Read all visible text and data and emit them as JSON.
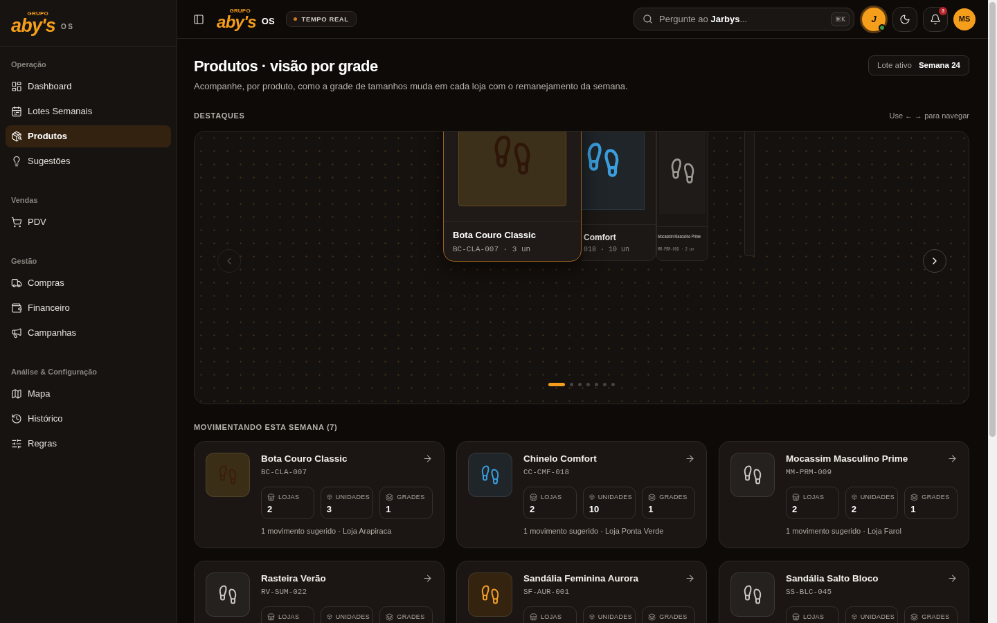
{
  "sidebar": {
    "logo": {
      "group": "GRUPO",
      "brand": "aby's",
      "suffix": "OS"
    },
    "sections": [
      {
        "title": "Operação",
        "items": [
          {
            "label": "Dashboard",
            "selected": false
          },
          {
            "label": "Lotes Semanais",
            "selected": false
          },
          {
            "label": "Produtos",
            "selected": true
          },
          {
            "label": "Sugestões",
            "selected": false
          }
        ]
      },
      {
        "title": "Vendas",
        "items": [
          {
            "label": "PDV",
            "selected": false
          }
        ]
      },
      {
        "title": "Gestão",
        "items": [
          {
            "label": "Compras",
            "selected": false
          },
          {
            "label": "Financeiro",
            "selected": false
          },
          {
            "label": "Campanhas",
            "selected": false
          }
        ]
      },
      {
        "title": "Análise & Configuração",
        "items": [
          {
            "label": "Mapa",
            "selected": false
          },
          {
            "label": "Histórico",
            "selected": false
          },
          {
            "label": "Regras",
            "selected": false
          }
        ]
      }
    ]
  },
  "header": {
    "logo": {
      "group": "GRUPO",
      "brand": "aby's",
      "suffix": "OS"
    },
    "status": {
      "label": "TEMPO REAL",
      "live": true
    },
    "search": {
      "placeholder": "Pergunte ao **Jarbys**...",
      "shortcut": "⌘K"
    },
    "assistant": {
      "initial": "J",
      "online": true
    },
    "notifications": {
      "count": "3"
    },
    "user": {
      "initials": "MS"
    }
  },
  "page": {
    "title": "Produtos · visão por grade",
    "subtitle": "Acompanhe, por produto, como a grade de tamanhos muda em cada loja com o remanejamento da semana.",
    "batch": {
      "label": "Lote ativo",
      "value": "Semana 24"
    }
  },
  "highlights": {
    "title": "DESTAQUES",
    "hint": "Use ← → para navegar",
    "prev": {
      "disabled": true
    },
    "next": {
      "disabled": false
    },
    "cards": [
      {
        "name": "Bota Couro Classic",
        "meta": "BC-CLA-007 · 3 un",
        "color": "#2e1608",
        "image": {
          "color": "#3d301a"
        },
        "selected": true
      },
      {
        "name": "Comfort",
        "meta": "018 · 10 un",
        "color": "#3b9ede",
        "image": {
          "color": "#1f2528"
        },
        "selected": false
      },
      {
        "name": "Mocassim Masculino Prime",
        "meta": "MM-PRM-009 · 2 un",
        "color": "#9e9892",
        "image": {
          "color": "#1e1b19"
        },
        "selected": false
      },
      {
        "selected": false
      }
    ],
    "dots": [
      {
        "selected": true
      },
      {
        "selected": false
      },
      {
        "selected": false
      },
      {
        "selected": false
      },
      {
        "selected": false
      },
      {
        "selected": false
      },
      {
        "selected": false
      }
    ]
  },
  "moving": {
    "title": "MOVIMENTANDO ESTA SEMANA (7)",
    "products": [
      {
        "name": "Bota Couro Classic",
        "code": "BC-CLA-007",
        "color": "#3b1d0c",
        "thumb": {
          "color": "#3b2e16"
        },
        "stats": [
          {
            "label": "LOJAS",
            "value": "2"
          },
          {
            "label": "UNIDADES",
            "value": "3"
          },
          {
            "label": "GRADES",
            "value": "1"
          }
        ],
        "note": "1 movimento sugerido · Loja Arapiraca"
      },
      {
        "name": "Chinelo Comfort",
        "code": "CC-CMF-018",
        "color": "#3b9ede",
        "thumb": {
          "color": "#1f2528"
        },
        "stats": [
          {
            "label": "LOJAS",
            "value": "2"
          },
          {
            "label": "UNIDADES",
            "value": "10"
          },
          {
            "label": "GRADES",
            "value": "1"
          }
        ],
        "note": "1 movimento sugerido · Loja Ponta Verde"
      },
      {
        "name": "Mocassim Masculino Prime",
        "code": "MM-PRM-009",
        "color": "#cdc8c2",
        "thumb": {
          "color": "#25211f"
        },
        "stats": [
          {
            "label": "LOJAS",
            "value": "2"
          },
          {
            "label": "UNIDADES",
            "value": "2"
          },
          {
            "label": "GRADES",
            "value": "1"
          }
        ],
        "note": "1 movimento sugerido · Loja Farol"
      },
      {
        "name": "Rasteira Verão",
        "code": "RV-SUM-022",
        "color": "#cdc8c2",
        "thumb": {
          "color": "#25211f"
        },
        "stats": [
          {
            "label": "LOJAS"
          },
          {
            "label": "UNIDADES"
          },
          {
            "label": "GRADES"
          }
        ]
      },
      {
        "name": "Sandália Feminina Aurora",
        "code": "SF-AUR-001",
        "color": "#f5a02a",
        "thumb": {
          "color": "#34230f"
        },
        "stats": [
          {
            "label": "LOJAS"
          },
          {
            "label": "UNIDADES"
          },
          {
            "label": "GRADES"
          }
        ]
      },
      {
        "name": "Sandália Salto Bloco",
        "code": "SS-BLC-045",
        "color": "#cdc8c2",
        "thumb": {
          "color": "#25211f"
        },
        "stats": [
          {
            "label": "LOJAS"
          },
          {
            "label": "UNIDADES"
          },
          {
            "label": "GRADES"
          }
        ]
      }
    ]
  }
}
